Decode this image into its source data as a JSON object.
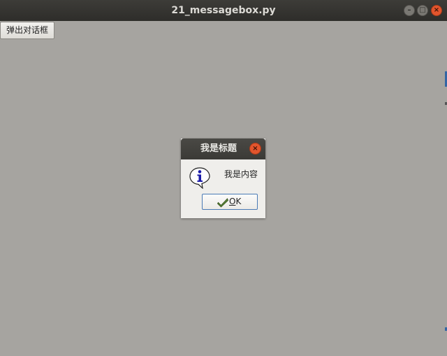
{
  "window": {
    "title": "21_messagebox.py",
    "minimize_glyph": "–",
    "maximize_glyph": "□",
    "close_glyph": "×"
  },
  "main": {
    "popup_button_label": "弹出对话框"
  },
  "dialog": {
    "title": "我是标题",
    "close_glyph": "×",
    "message": "我是内容",
    "icon": "info-icon",
    "ok_mnemonic": "O",
    "ok_rest": "K"
  },
  "colors": {
    "titlebar": "#2e2d2a",
    "background": "#a6a4a0",
    "close_button": "#e2552d",
    "dialog_body": "#efeeeb",
    "ok_border": "#4a7ab5"
  }
}
